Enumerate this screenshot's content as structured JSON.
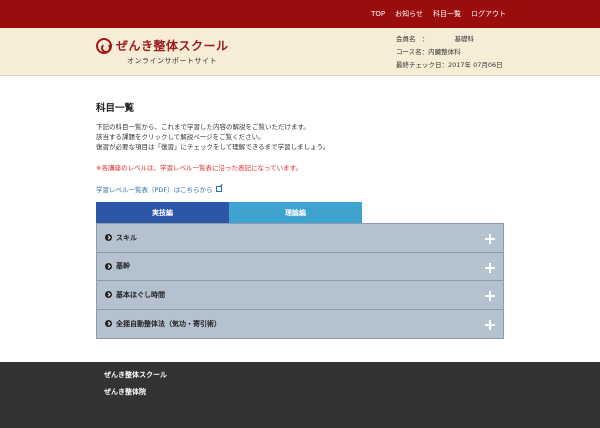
{
  "topnav": {
    "items": [
      "TOP",
      "お知らせ",
      "科目一覧",
      "ログアウト"
    ]
  },
  "header": {
    "logo_title": "ぜんき整体スクール",
    "logo_sub": "オンラインサポートサイト",
    "user": {
      "member_label": "会員名　：",
      "member_value": "基礎科",
      "course": "コース名：内臓整体科",
      "last_check": "最終チェック日：2017年 07月06日"
    }
  },
  "main": {
    "title": "科目一覧",
    "desc_lines": [
      "下記の科目一覧から、これまで学習した内容の解説をご覧いただけます。",
      "該当する課題をクリックして解説ページをご覧ください。",
      "復習が必要な項目は「復習」にチェックをして理解できるまで学習しましょう。"
    ],
    "notice": "※各講座のレベルは、学習レベル一覧表に沿った表記になっています。",
    "pdf_link": "学習レベル一覧表（PDF）はこちらから"
  },
  "tabs": [
    {
      "label": "実技編",
      "active": true
    },
    {
      "label": "理論編",
      "active": false
    }
  ],
  "accordion": [
    {
      "label": "スキル"
    },
    {
      "label": "基幹"
    },
    {
      "label": "基本ほぐし時間"
    },
    {
      "label": "全揺自動整体法（気功・寄引術）"
    }
  ],
  "footer": {
    "links": [
      "ぜんき整体スクール",
      "ぜんき整体院"
    ]
  },
  "colors": {
    "topbar": "#9b0c0c",
    "header_bg": "#f7ecd6",
    "tab_active": "#2d56a6",
    "tab_inactive": "#3fa3d0",
    "accordion_bg": "#b4c1cf",
    "footer_bg": "#333333",
    "notice": "#e02a2a",
    "link": "#2f6db5"
  }
}
